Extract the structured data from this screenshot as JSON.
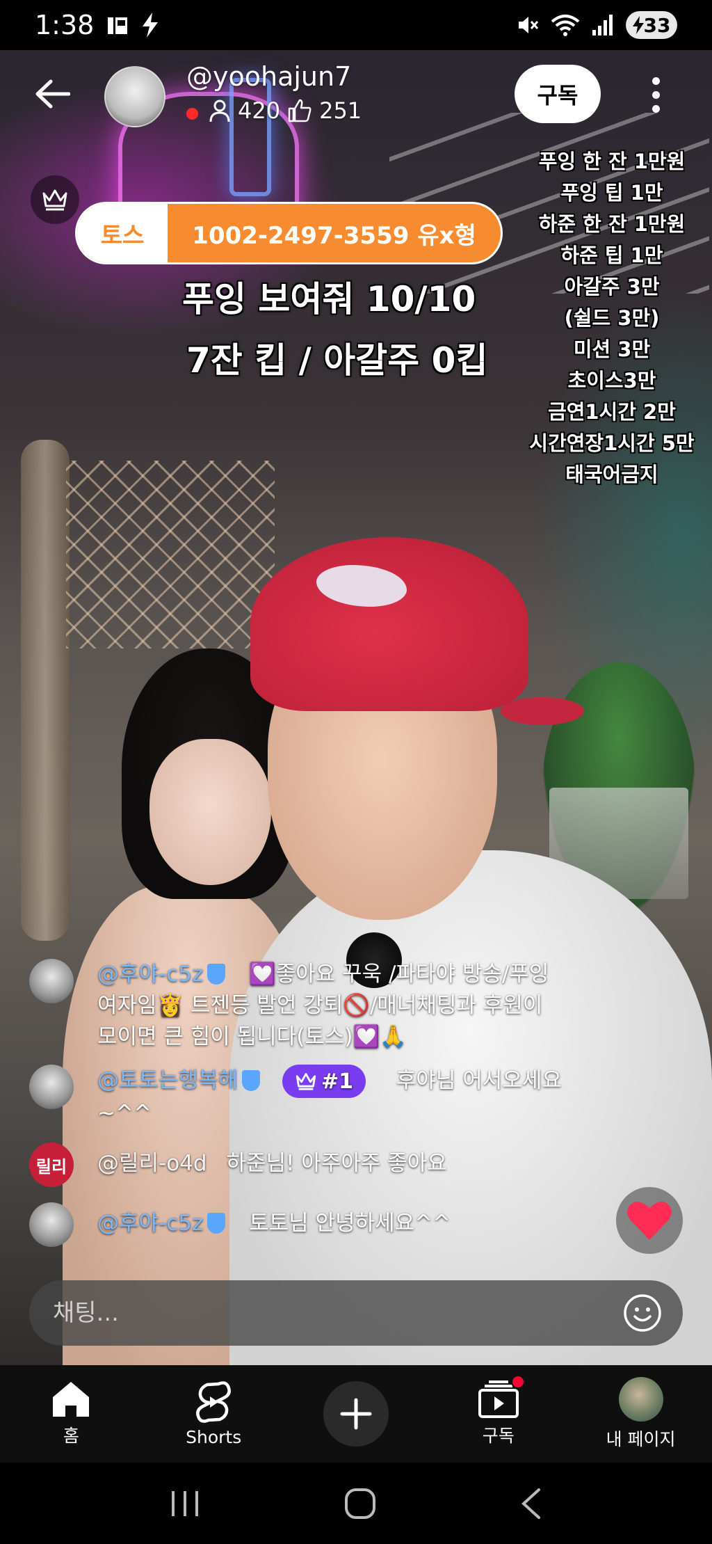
{
  "status_bar": {
    "time": "1:38",
    "battery": "33",
    "icons": [
      "gallery-icon",
      "bolt-icon",
      "mute-icon",
      "wifi-icon",
      "signal-icon",
      "battery-charging-icon"
    ]
  },
  "channel": {
    "name": "@yoohajun7",
    "viewers": "420",
    "likes": "251",
    "subscribe_label": "구독"
  },
  "overlay": {
    "toss_tag": "토스",
    "toss_account": "1002-2497-3559 유x형",
    "headline_1": "푸잉 보여줘 10/10",
    "headline_2": "7잔 킵 / 아갈주 0킵",
    "price_list": [
      "푸잉 한 잔 1만원",
      "푸잉 팁 1만",
      "하준 한 잔 1만원",
      "하준 팁 1만",
      "아갈주 3만",
      "(쉴드 3만)",
      "미션 3만",
      "초이스3만",
      "금연1시간 2만",
      "시간연장1시간 5만",
      "태국어금지"
    ]
  },
  "chat": {
    "messages": [
      {
        "user": "@후야-c5z",
        "line1": "💟좋아요 꾸욱 /파타야 방송/푸잉",
        "line2": "여자임👸 트젠등 발언 강퇴🚫/매너채팅과 후원이",
        "line3": "모이면 큰 힘이 됩니다(토스)💟🙏"
      },
      {
        "user": "@토토는행복해",
        "badge": "#1",
        "line1": "후야님 어서오세요",
        "line2": "~^^"
      },
      {
        "user": "@릴리-o4d",
        "avatar_text": "릴리",
        "line1": "하준님! 아주아주 좋아요"
      },
      {
        "user": "@후야-c5z",
        "line1": "토토님 안녕하세요^^"
      }
    ],
    "input_placeholder": "채팅..."
  },
  "bottom_nav": {
    "home": "홈",
    "shorts": "Shorts",
    "subscriptions": "구독",
    "my_page": "내 페이지"
  },
  "colors": {
    "toss_orange": "#f68c2f",
    "username_blue": "#7ab8ff",
    "rank_badge_purple": "#7a3cf0",
    "like_red": "#ff2d55",
    "notification_red": "#ff0033"
  }
}
